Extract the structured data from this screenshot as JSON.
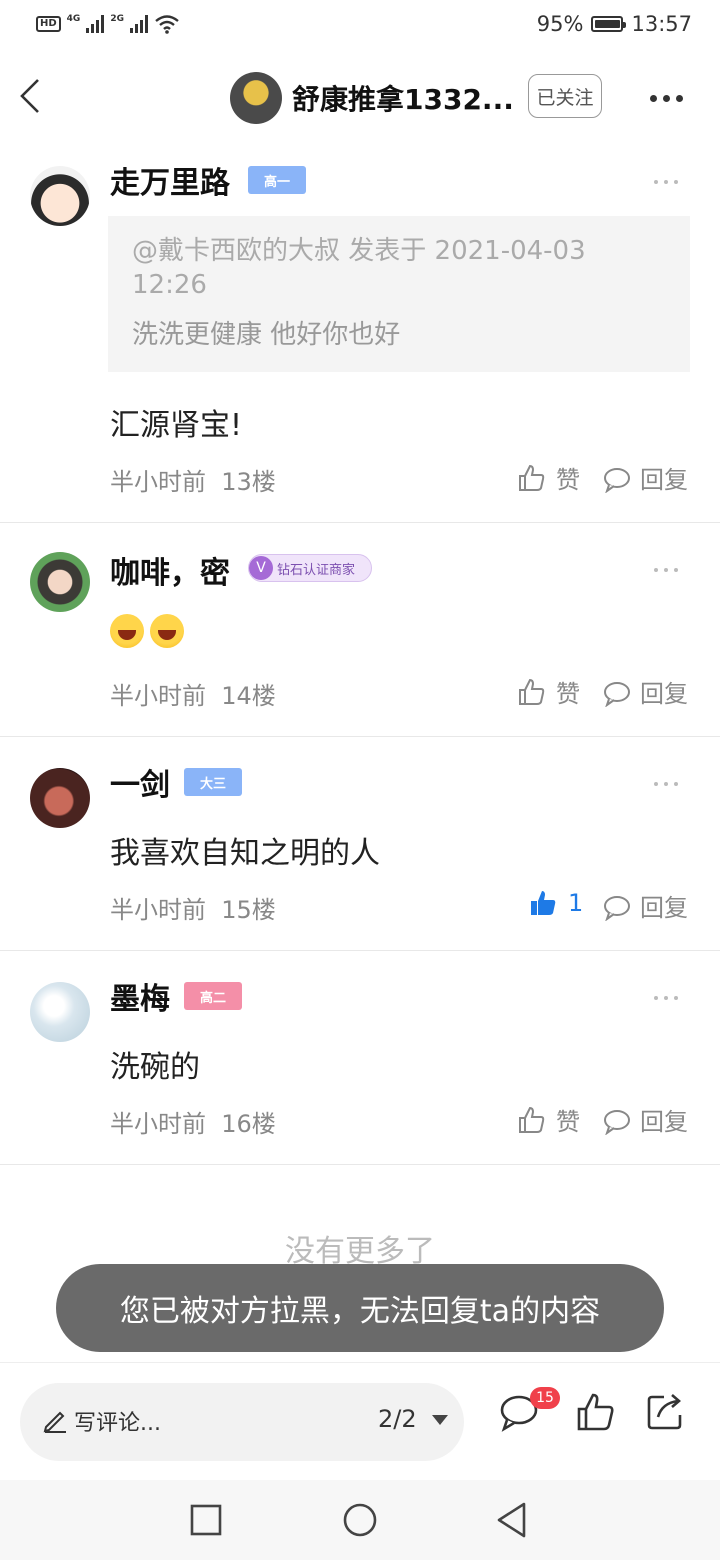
{
  "status_bar": {
    "battery_percent": "95%",
    "time": "13:57",
    "network_1": "4G",
    "network_2": "2G",
    "hd": "HD"
  },
  "header": {
    "title": "舒康推拿1332...",
    "follow_label": "已关注"
  },
  "comments": [
    {
      "username": "走万里路",
      "badge": "高一",
      "badge_color": "#8ab4f8",
      "quote": {
        "author_line": "@戴卡西欧的大叔 发表于 2021-04-03 12:26",
        "text": "洗洗更健康 他好你也好"
      },
      "text": "汇源肾宝!",
      "time": "半小时前",
      "floor": "13楼",
      "like_label": "赞",
      "reply_label": "回复"
    },
    {
      "username": "咖啡，密",
      "badge": "钻石认证商家",
      "badge_color": "#b67bd8",
      "text_emojis": [
        "grin-emoji",
        "grin-emoji"
      ],
      "time": "半小时前",
      "floor": "14楼",
      "like_label": "赞",
      "reply_label": "回复"
    },
    {
      "username": "一剑",
      "badge": "大三",
      "badge_color": "#8ab4f8",
      "text": "我喜欢自知之明的人",
      "time": "半小时前",
      "floor": "15楼",
      "like_label": "1",
      "liked": true,
      "reply_label": "回复"
    },
    {
      "username": "墨梅",
      "badge": "高二",
      "badge_color": "#f48fa8",
      "text": "洗碗的",
      "time": "半小时前",
      "floor": "16楼",
      "like_label": "赞",
      "reply_label": "回复"
    }
  ],
  "no_more": "没有更多了",
  "toast": "您已被对方拉黑，无法回复ta的内容",
  "bottom_bar": {
    "placeholder": "写评论...",
    "page": "2/2",
    "comment_count": "15"
  },
  "colors": {
    "accent_blue": "#1e7ae6",
    "badge_red": "#f0404a"
  }
}
